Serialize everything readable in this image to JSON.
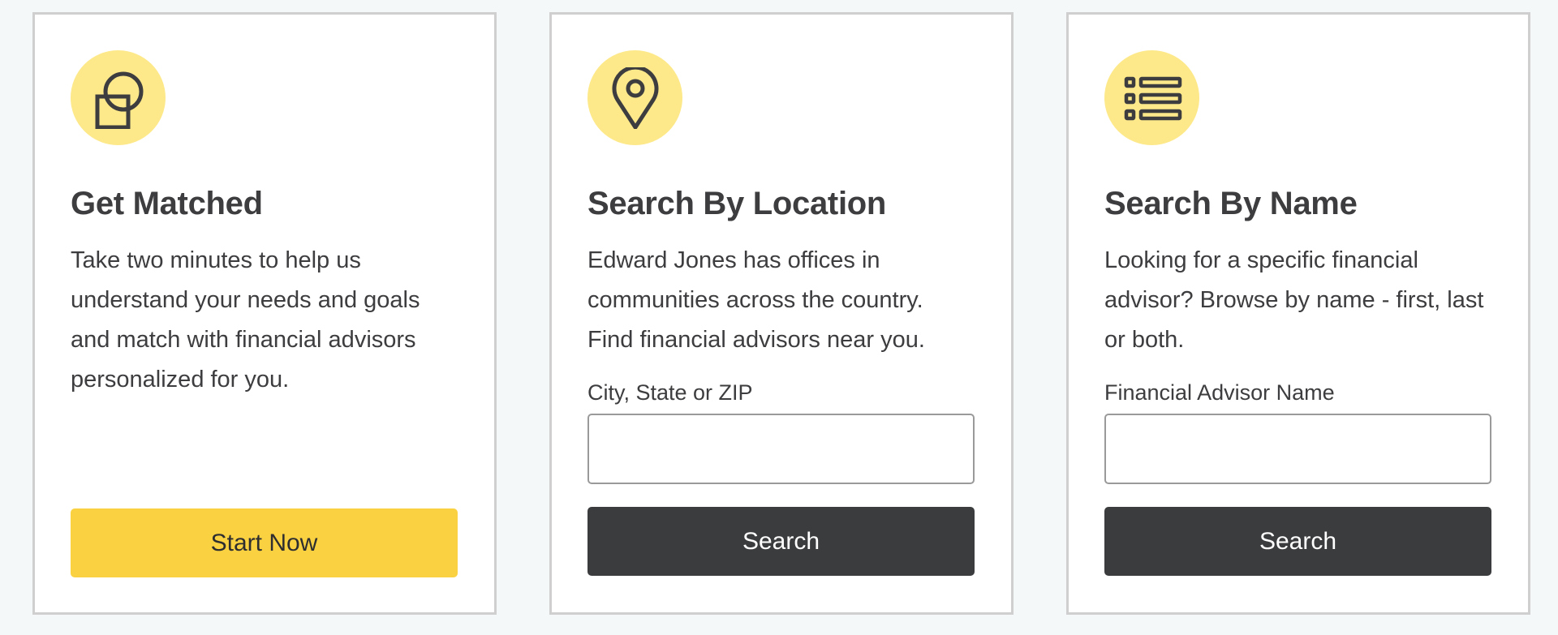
{
  "cards": [
    {
      "icon": "shapes-icon",
      "title": "Get Matched",
      "description": "Take two minutes to help us understand your needs and goals and match with financial advisors personalized for you.",
      "button_label": "Start Now"
    },
    {
      "icon": "map-pin-icon",
      "title": "Search By Location",
      "description": "Edward Jones has offices in communities across the country. Find financial advisors near you.",
      "field_label": "City, State or ZIP",
      "field_value": "",
      "button_label": "Search"
    },
    {
      "icon": "list-icon",
      "title": "Search By Name",
      "description": "Looking for a specific financial advisor? Browse by name - first, last or both.",
      "field_label": "Financial Advisor Name",
      "field_value": "",
      "button_label": "Search"
    }
  ],
  "colors": {
    "page_background": "#f5f8f9",
    "card_border": "#cfcfcf",
    "icon_circle": "#fde98a",
    "primary_button": "#fad241",
    "dark_button": "#3b3c3e",
    "text": "#3d3d3f"
  }
}
